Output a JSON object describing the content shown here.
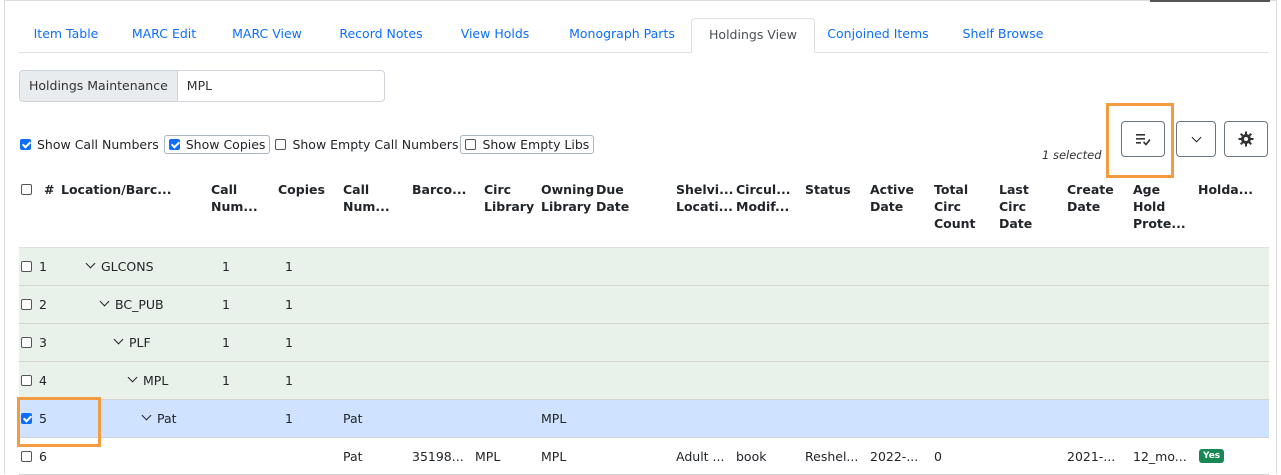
{
  "tabs": [
    "Item Table",
    "MARC Edit",
    "MARC View",
    "Record Notes",
    "View Holds",
    "Monograph Parts",
    "Holdings View",
    "Conjoined Items",
    "Shelf Browse"
  ],
  "active_tab": "Holdings View",
  "holdings": {
    "label": "Holdings Maintenance",
    "value": "MPL"
  },
  "show_options": {
    "call_numbers": "Show Call Numbers",
    "copies": "Show Copies",
    "empty_call_numbers": "Show Empty Call Numbers",
    "empty_libs": "Show Empty Libs"
  },
  "selection": {
    "text": "1 selected"
  },
  "icons": {
    "columns": "list-check-icon",
    "dropdown": "chevron-down-icon",
    "settings": "gear-icon"
  },
  "columns": [
    "#",
    "Location/Barc...",
    "Call Num...",
    "Copies",
    "Call Num...",
    "Barco...",
    "Circ Library",
    "Owning Library",
    "Due Date",
    "Shelvi... Locati...",
    "Circul... Modif...",
    "Status",
    "Active Date",
    "Total Circ Count",
    "Last Circ Date",
    "Create Date",
    "Age Hold Prote...",
    "Holda..."
  ],
  "rows": [
    {
      "num": "1",
      "location": "GLCONS",
      "call_num_count": "1",
      "copies": "1"
    },
    {
      "num": "2",
      "location": "BC_PUB",
      "call_num_count": "1",
      "copies": "1"
    },
    {
      "num": "3",
      "location": "PLF",
      "call_num_count": "1",
      "copies": "1"
    },
    {
      "num": "4",
      "location": "MPL",
      "call_num_count": "1",
      "copies": "1"
    },
    {
      "num": "5",
      "location": "Pat",
      "copies": "1",
      "call_number": "Pat",
      "owning_library": "MPL"
    },
    {
      "num": "6",
      "call_number": "Pat",
      "barcode": "35198...",
      "circ_library": "MPL",
      "owning_library": "MPL",
      "shelving_location": "Adult ...",
      "circ_modifier": "book",
      "status": "Reshel...",
      "active_date": "2022-...",
      "total_circ": "0",
      "create_date": "2021-...",
      "age_hold": "12_mo...",
      "holdable": "Yes"
    }
  ],
  "colors": {
    "accent": "#0d6efd",
    "highlight": "#f39c3f",
    "row_green": "#e8f2ea",
    "row_selected": "#cfe2ff",
    "badge": "#198754"
  }
}
